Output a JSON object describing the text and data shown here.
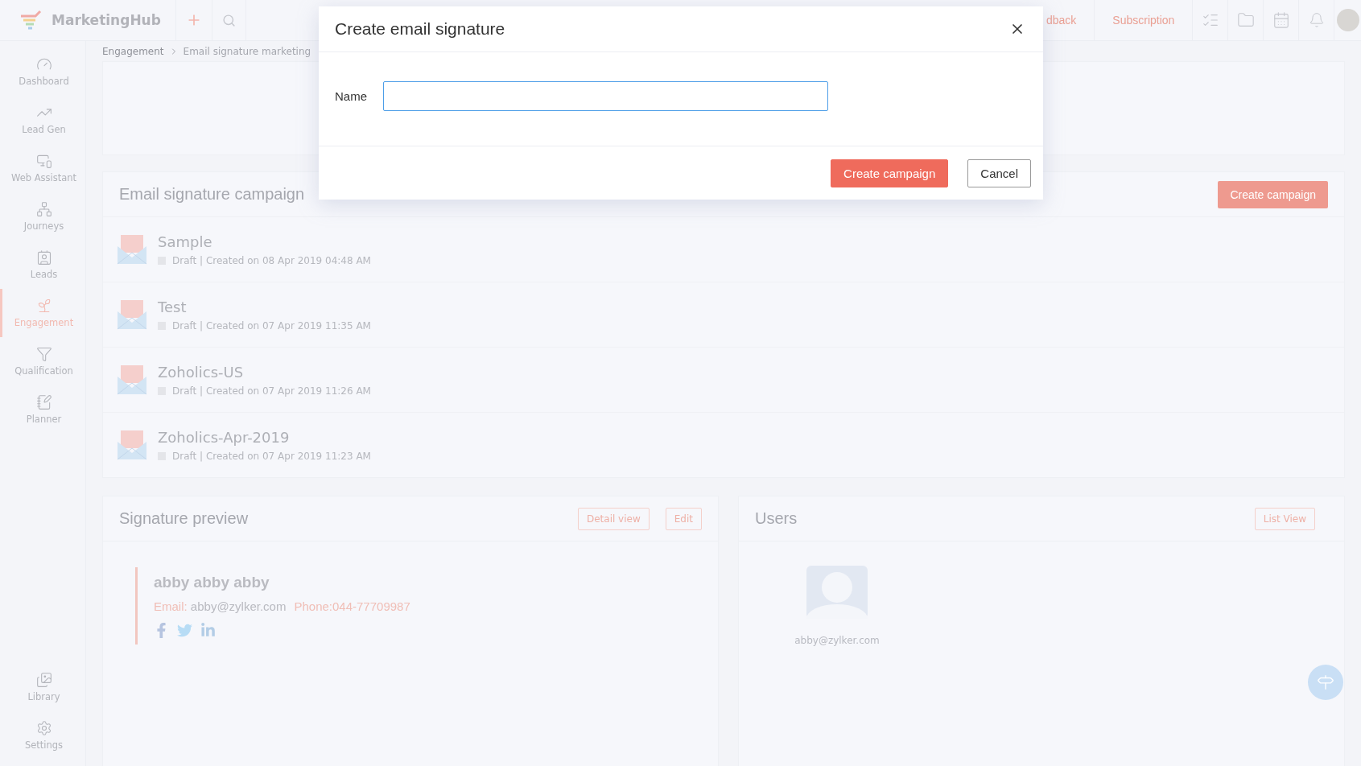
{
  "header": {
    "app_name": "MarketingHub",
    "links": [
      {
        "label": "dback"
      },
      {
        "label": "Subscription"
      }
    ]
  },
  "sidebar": {
    "items": [
      {
        "label": "Dashboard",
        "selected": false
      },
      {
        "label": "Lead Gen",
        "selected": false
      },
      {
        "label": "Web Assistant",
        "selected": false
      },
      {
        "label": "Journeys",
        "selected": false
      },
      {
        "label": "Leads",
        "selected": false
      },
      {
        "label": "Engagement",
        "selected": true
      },
      {
        "label": "Qualification",
        "selected": false
      },
      {
        "label": "Planner",
        "selected": false
      }
    ],
    "bottom_items": [
      {
        "label": "Library",
        "selected": false
      },
      {
        "label": "Settings",
        "selected": false
      }
    ]
  },
  "breadcrumb": [
    "Engagement",
    "Email signature marketing"
  ],
  "campaigns": {
    "title": "Email signature campaign",
    "button": "Create campaign",
    "rows": [
      {
        "name": "Sample",
        "meta": "Draft | Created on 08 Apr 2019 04:48 AM"
      },
      {
        "name": "Test",
        "meta": "Draft | Created on 07 Apr 2019 11:35 AM"
      },
      {
        "name": "Zoholics-US",
        "meta": "Draft | Created on 07 Apr 2019 11:26 AM"
      },
      {
        "name": "Zoholics-Apr-2019",
        "meta": "Draft | Created on 07 Apr 2019 11:23 AM"
      }
    ]
  },
  "signature_preview": {
    "title": "Signature preview",
    "buttons": [
      "Detail view",
      "Edit"
    ],
    "name": "abby abby abby",
    "email_label": "Email:",
    "email": "abby@zylker.com",
    "phone": "Phone:044-77709987"
  },
  "users": {
    "title": "Users",
    "button": "List View",
    "items": [
      {
        "email": "abby@zylker.com"
      }
    ]
  },
  "modal": {
    "title": "Create email signature",
    "fields": [
      {
        "label": "Name",
        "focused": true
      }
    ],
    "buttons": [
      {
        "label": "Create campaign",
        "kind": "primary"
      },
      {
        "label": "Cancel",
        "kind": "secondary"
      }
    ]
  }
}
